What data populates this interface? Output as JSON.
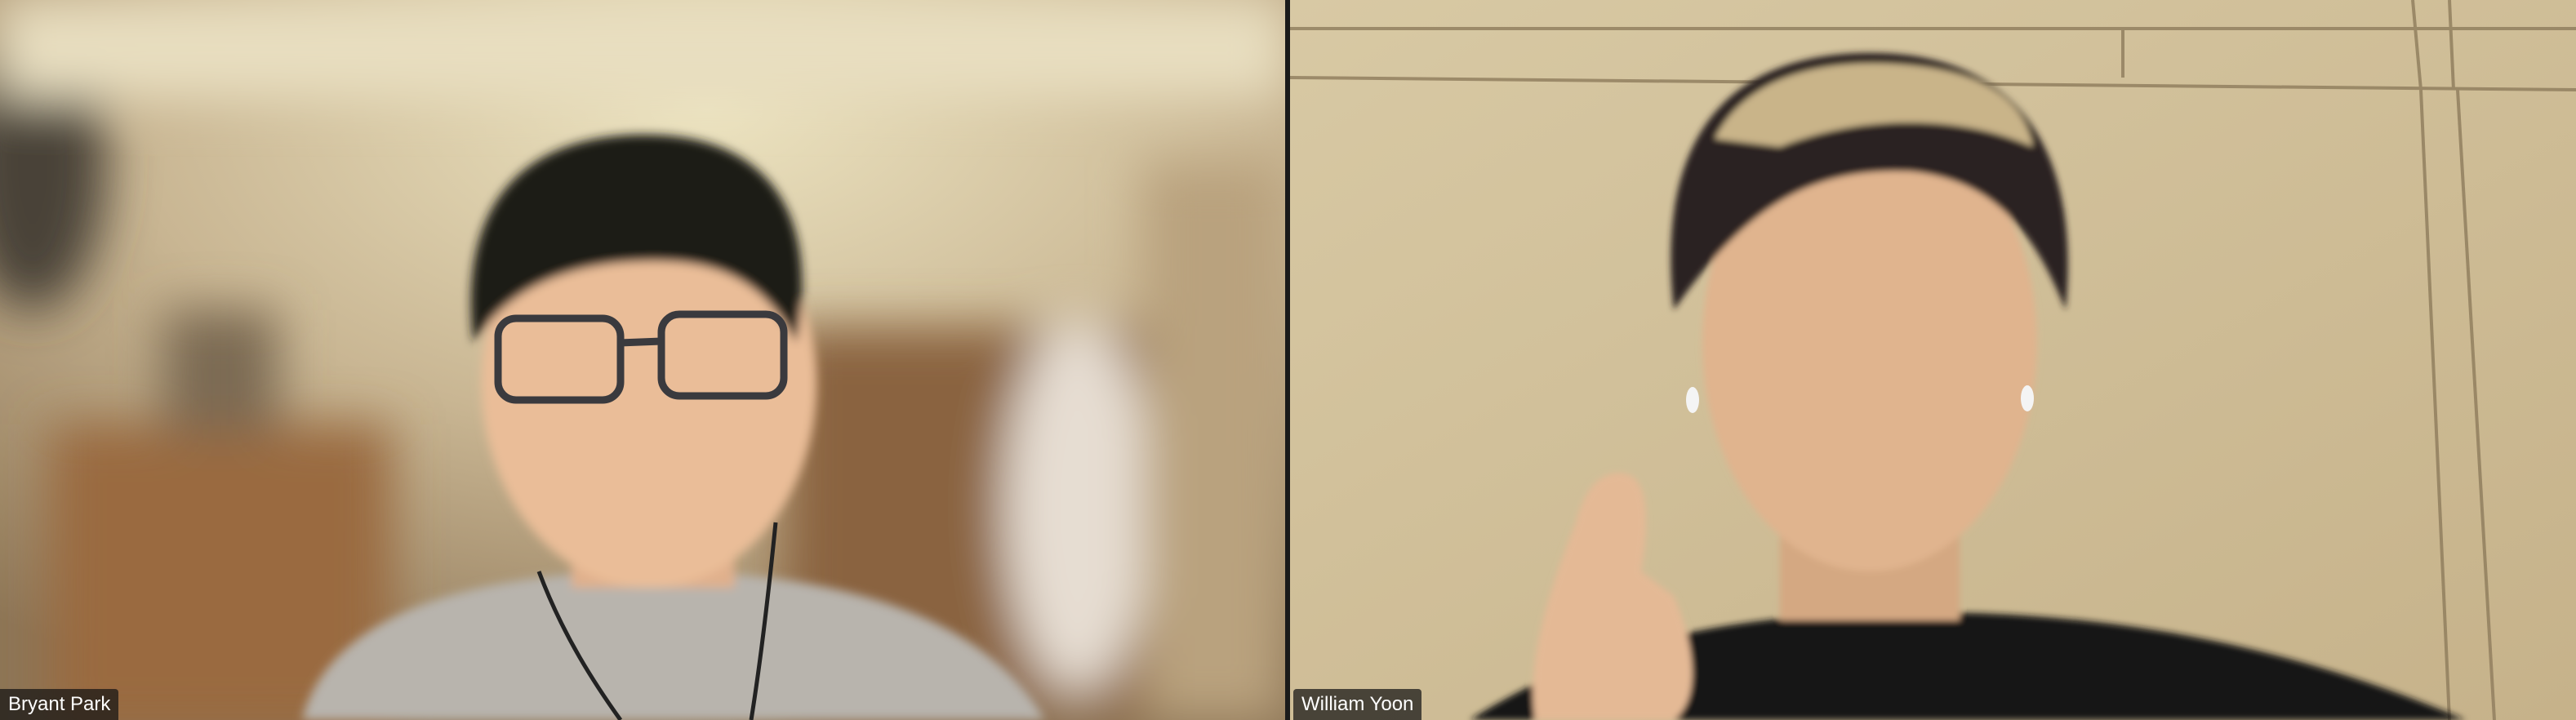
{
  "participants": [
    {
      "name": "Bryant Park",
      "video_state": "camera-on"
    },
    {
      "name": "William Yoon",
      "video_state": "camera-on"
    }
  ],
  "colors": {
    "gallery_background": "#1a1a1a",
    "name_tag_background": "#141414",
    "name_tag_text": "#ffffff"
  }
}
